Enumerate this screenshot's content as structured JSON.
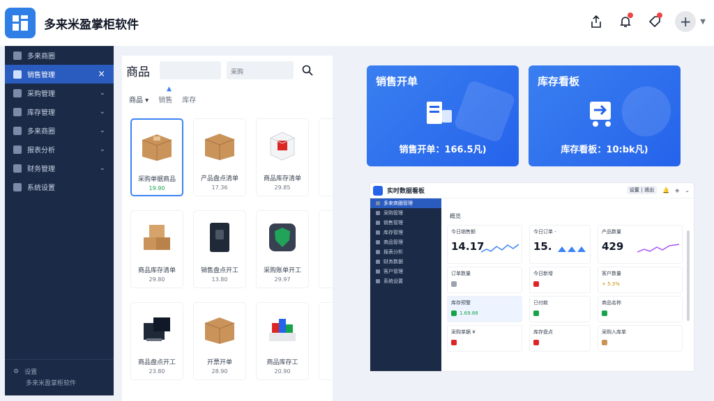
{
  "header": {
    "app_title": "多来米盈掌柜软件",
    "logo_icon": "grid-logo-icon",
    "actions": [
      "share-icon",
      "bell-icon",
      "tag-icon",
      "plus-icon",
      "chevron-down-icon"
    ],
    "plus_label": "+"
  },
  "sidebar": {
    "items": [
      {
        "label": "多来商圈",
        "icon": "search-icon",
        "right": ""
      },
      {
        "label": "销售管理",
        "icon": "users-icon",
        "right": "×",
        "active": true
      },
      {
        "label": "采购管理",
        "icon": "cart-icon",
        "right": "⌄"
      },
      {
        "label": "库存管理",
        "icon": "cart-icon",
        "right": "⌄"
      },
      {
        "label": "多来商圈",
        "icon": "box-icon",
        "right": "⌄"
      },
      {
        "label": "报表分析",
        "icon": "chart-icon",
        "right": "⌄"
      },
      {
        "label": "财务管理",
        "icon": "wallet-icon",
        "right": "⌄"
      },
      {
        "label": "系统设置",
        "icon": "gear-icon",
        "right": ""
      }
    ],
    "footer_line1": "设置",
    "footer_line2": "多来米盈掌柜软件"
  },
  "products": {
    "search_label": "商品",
    "search_value": "",
    "search2_value": "采购",
    "filters": [
      "商品 ▾",
      "销售",
      "库存"
    ],
    "items": [
      {
        "name": "采购单据商品",
        "price": "19.90",
        "price_color": "green",
        "selected": true,
        "thumb": "box"
      },
      {
        "name": "产品盘点清单",
        "price": "17.36",
        "thumb": "box"
      },
      {
        "name": "商品库存清单",
        "price": "29.85",
        "thumb": "redbox"
      },
      {
        "name": "",
        "price": "",
        "thumb": "partial"
      },
      {
        "name": "商品库存清单",
        "price": "29.80",
        "thumb": "boxes"
      },
      {
        "name": "销售盘点开工",
        "price": "13.80",
        "thumb": "safe"
      },
      {
        "name": "采购账单开工",
        "price": "29.97",
        "thumb": "shield"
      },
      {
        "name": "",
        "price": "",
        "thumb": "partial"
      },
      {
        "name": "商品盘点开工",
        "price": "23.80",
        "thumb": "machine"
      },
      {
        "name": "开票开单",
        "price": "28.90",
        "thumb": "box"
      },
      {
        "name": "商品库存工",
        "price": "20.90",
        "thumb": "blocks"
      },
      {
        "name": "",
        "price": "",
        "thumb": "partial"
      }
    ]
  },
  "kpis": [
    {
      "title": "销售开单",
      "value": "销售开单：166.5凡)",
      "icon": "receipt-icon"
    },
    {
      "title": "库存看板",
      "value": "库存看板：10:bk凡)",
      "icon": "inventory-icon"
    }
  ],
  "embed": {
    "title": "实时数据看板",
    "header_pill": "设置 | 退出",
    "sidebar_items": [
      "多来商圈管理",
      "采购管理",
      "销售管理",
      "库存管理",
      "商品管理",
      "报表分析",
      "财务数据",
      "客户管理",
      "系统设置"
    ],
    "heading": "概览",
    "cards": [
      {
        "title": "今日销售额",
        "value": "14.17"
      },
      {
        "title": "今日订单 -",
        "value": "15."
      },
      {
        "title": "产品数量",
        "value": "429"
      }
    ],
    "col1_rows": [
      "订单数量",
      "库存预警",
      "1.69.88",
      "采购单据 ¥"
    ],
    "col2_rows": [
      "今日新增",
      "已付款",
      "库存盘点"
    ],
    "col3_rows": [
      "客户数量",
      "+ 5.3%",
      "商品名称",
      "采购入库单"
    ]
  }
}
